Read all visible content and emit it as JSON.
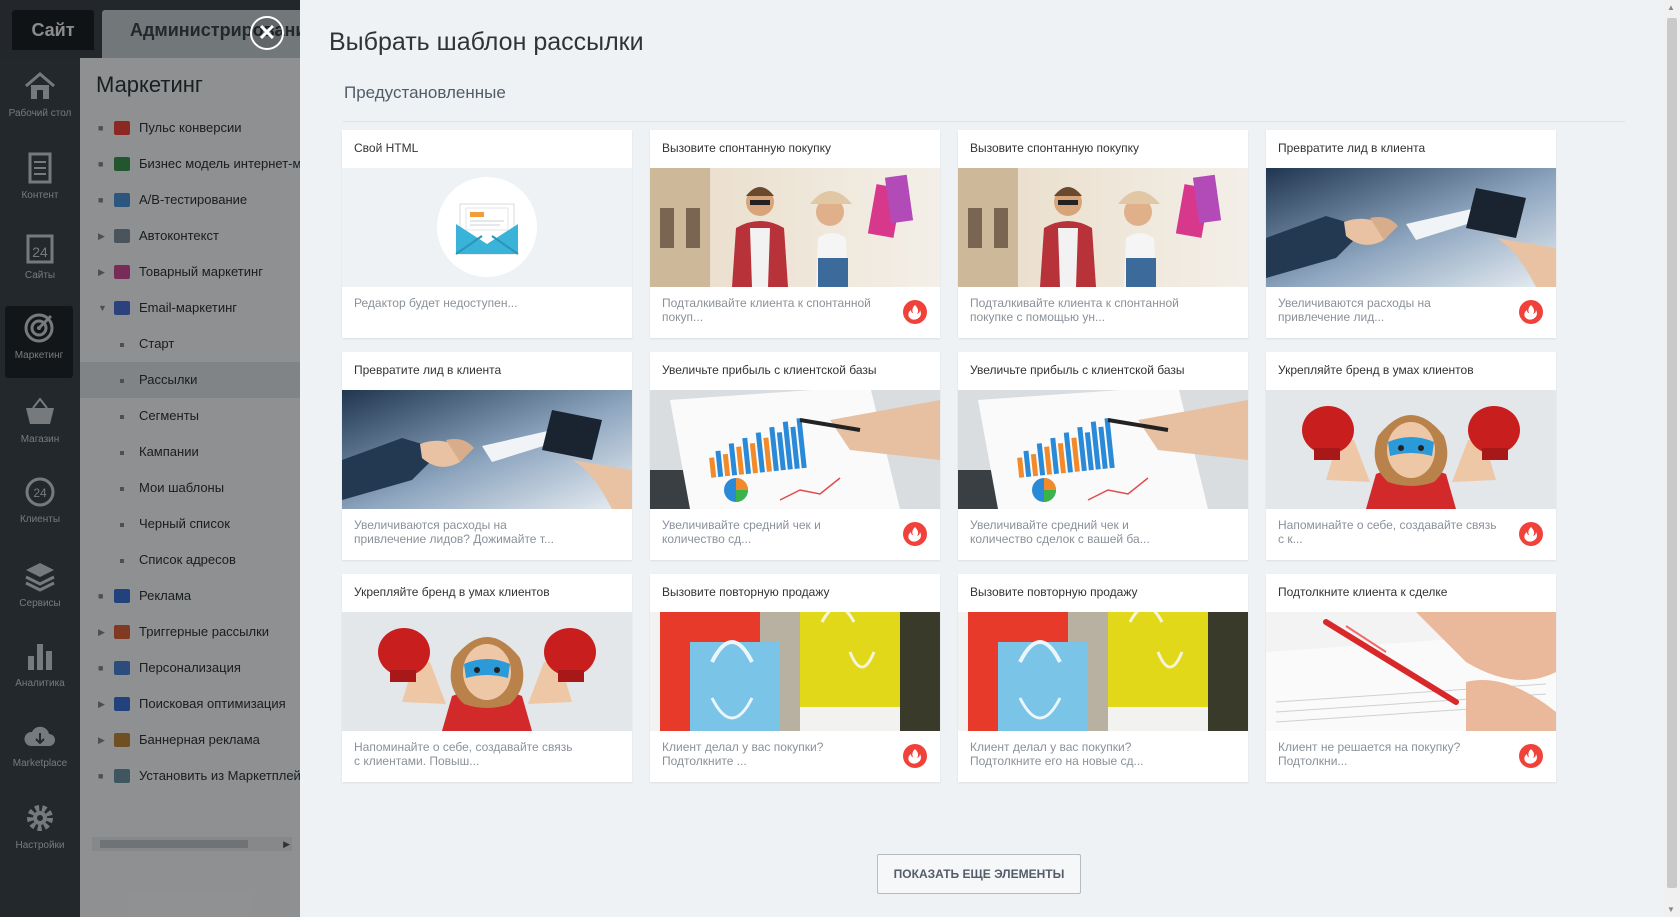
{
  "admin": {
    "tab_site": "Сайт",
    "tab_admin": "Администрирование",
    "iconbar": [
      {
        "label": "Рабочий стол",
        "icon": "home-icon"
      },
      {
        "label": "Контент",
        "icon": "document-icon"
      },
      {
        "label": "Сайты",
        "icon": "calendar-24-icon"
      },
      {
        "label": "Маркетинг",
        "icon": "target-icon"
      },
      {
        "label": "Магазин",
        "icon": "basket-icon"
      },
      {
        "label": "Клиенты",
        "icon": "clients-24-icon"
      },
      {
        "label": "Сервисы",
        "icon": "layers-icon"
      },
      {
        "label": "Аналитика",
        "icon": "bar-chart-icon"
      },
      {
        "label": "Marketplace",
        "icon": "cloud-download-icon"
      },
      {
        "label": "Настройки",
        "icon": "gear-icon"
      }
    ],
    "menu_title": "Маркетинг",
    "menu": [
      {
        "label": "Пульс конверсии",
        "type": "bullet"
      },
      {
        "label": "Бизнес модель интернет-магазина",
        "type": "bullet"
      },
      {
        "label": "A/B-тестирование",
        "type": "bullet"
      },
      {
        "label": "Автоконтекст",
        "type": "arrow"
      },
      {
        "label": "Товарный маркетинг",
        "type": "arrow"
      },
      {
        "label": "Email-маркетинг",
        "type": "open"
      },
      {
        "label": "Старт",
        "type": "sub"
      },
      {
        "label": "Рассылки",
        "type": "sub-selected"
      },
      {
        "label": "Сегменты",
        "type": "sub"
      },
      {
        "label": "Кампании",
        "type": "sub"
      },
      {
        "label": "Мои шаблоны",
        "type": "sub"
      },
      {
        "label": "Черный список",
        "type": "sub"
      },
      {
        "label": "Список адресов",
        "type": "sub"
      },
      {
        "label": "Реклама",
        "type": "bullet"
      },
      {
        "label": "Триггерные рассылки",
        "type": "arrow"
      },
      {
        "label": "Персонализация",
        "type": "bullet"
      },
      {
        "label": "Поисковая оптимизация",
        "type": "arrow"
      },
      {
        "label": "Баннерная реклама",
        "type": "arrow"
      },
      {
        "label": "Установить из Маркетплейс",
        "type": "bullet"
      }
    ]
  },
  "panel": {
    "close_symbol": "✕",
    "title": "Выбрать шаблон рассылки",
    "section": "Предустановленные",
    "show_more": "ПОКАЗАТЬ ЕЩЕ ЭЛЕМЕНТЫ"
  },
  "cards": [
    {
      "title": "Свой HTML",
      "desc": "Редактор будет недоступен...",
      "image": "envelope",
      "fire": false
    },
    {
      "title": "Вызовите спонтанную покупку",
      "desc": "Подталкивайте клиента к спонтанной покуп...",
      "image": "shoppers",
      "fire": true
    },
    {
      "title": "Вызовите спонтанную покупку",
      "desc": "Подталкивайте клиента к спонтанной покупке с помощью ун...",
      "image": "shoppers",
      "fire": false
    },
    {
      "title": "Превратите лид в клиента",
      "desc": "Увеличиваются расходы на привлечение лид...",
      "image": "handshake",
      "fire": true
    },
    {
      "title": "Превратите лид в клиента",
      "desc": "Увеличиваются расходы на привлечение лидов? Дожимайте т...",
      "image": "handshake",
      "fire": false
    },
    {
      "title": "Увеличьте прибыль с клиентской базы",
      "desc": "Увеличивайте средний чек и количество сд...",
      "image": "report",
      "fire": true
    },
    {
      "title": "Увеличьте прибыль с клиентской базы",
      "desc": "Увеличивайте средний чек и количество сделок с вашей ба...",
      "image": "report",
      "fire": false
    },
    {
      "title": "Укрепляйте бренд в умах клиентов",
      "desc": "Напоминайте о себе, создавайте связь с к...",
      "image": "boxer",
      "fire": true
    },
    {
      "title": "Укрепляйте бренд в умах клиентов",
      "desc": "Напоминайте о себе, создавайте связь с клиентами. Повыш...",
      "image": "boxer",
      "fire": false
    },
    {
      "title": "Вызовите повторную продажу",
      "desc": "Клиент делал у вас покупки? Подтолкните ...",
      "image": "bags",
      "fire": true
    },
    {
      "title": "Вызовите повторную продажу",
      "desc": "Клиент делал у вас покупки? Подтолкните его на новые сд...",
      "image": "bags",
      "fire": false
    },
    {
      "title": "Подтолкните клиента к сделке",
      "desc": "Клиент не решается на покупку? Подтолкни...",
      "image": "signing",
      "fire": true
    }
  ]
}
